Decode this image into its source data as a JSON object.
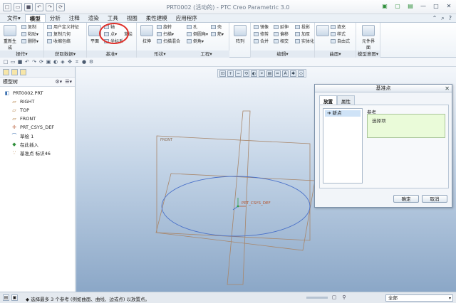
{
  "window": {
    "title": "PRT0002 (活动的) - PTC Creo Parametric 3.0",
    "quick_access": [
      "new-icon",
      "open-icon",
      "save-icon",
      "undo-icon",
      "redo-icon",
      "regenerate-icon"
    ]
  },
  "ribbon": {
    "tabs": [
      "文件▾",
      "模型",
      "分析",
      "注释",
      "渲染",
      "工具",
      "视图",
      "柔性建模",
      "应用程序"
    ],
    "active_tab": "模型",
    "groups": [
      {
        "caption": "操作▾",
        "items": [
          "重新生成",
          "复制",
          "粘贴▾",
          "删除▾"
        ]
      },
      {
        "caption": "获取数据▾",
        "items": [
          "用户定义特征",
          "复制几何",
          "收缩包络"
        ]
      },
      {
        "caption": "基准▾",
        "items": [
          "平面",
          "轴",
          "点▾",
          "坐标系",
          "草绘"
        ]
      },
      {
        "caption": "形状▾",
        "items": [
          "拉伸",
          "旋转",
          "扫描▾",
          "扫描混合",
          "孔",
          "倒圆角▾",
          "倒角▾",
          "壳",
          "筋▾"
        ]
      },
      {
        "caption": "工程▾",
        "items": [
          "阵列"
        ]
      },
      {
        "caption": "编辑▾",
        "items": [
          "镜像",
          "延伸",
          "投影",
          "修剪",
          "偏移",
          "加厚",
          "合并",
          "相交",
          "实体化"
        ]
      },
      {
        "caption": "曲面▾",
        "items": [
          "填充",
          "样式",
          "自由式"
        ]
      },
      {
        "caption": "模型意图▾",
        "items": [
          "元件界面"
        ]
      }
    ]
  },
  "model_tree": {
    "header": "模型树",
    "items": [
      {
        "label": "PRT0002.PRT",
        "icon": "part-icon"
      },
      {
        "label": "RIGHT",
        "icon": "datum-plane-icon"
      },
      {
        "label": "TOP",
        "icon": "datum-plane-icon"
      },
      {
        "label": "FRONT",
        "icon": "datum-plane-icon"
      },
      {
        "label": "PRT_CSYS_DEF",
        "icon": "csys-icon"
      },
      {
        "label": "草绘 1",
        "icon": "sketch-icon"
      },
      {
        "label": "在此插入",
        "icon": "insert-here-icon"
      },
      {
        "label": "基准点 标识46",
        "icon": "datum-point-icon"
      }
    ]
  },
  "graphics": {
    "labels": {
      "front": "FRONT",
      "csys": "PRT_CSYS_DEF"
    }
  },
  "dialog": {
    "title": "基准点",
    "tabs": [
      "放置",
      "属性"
    ],
    "active_tab": "放置",
    "point_list": [
      "新点"
    ],
    "reference_label": "参考",
    "reference_placeholder": "选择项",
    "ok_label": "确定",
    "cancel_label": "取消"
  },
  "status": {
    "message": "◆ 选择最多 3 个参考 (例如曲面、曲线、边或点) 以放置点。",
    "filter_value": "全部"
  },
  "colors": {
    "ribbon_bg": "#eef3f8",
    "graphics_top": "#f4f7fb",
    "graphics_bottom": "#8ba7c7",
    "datum_plane": "#a8866a",
    "sketch_ellipse": "#4b72c9",
    "annotation_circle": "#e0302a",
    "csys_label": "#b4532c"
  }
}
